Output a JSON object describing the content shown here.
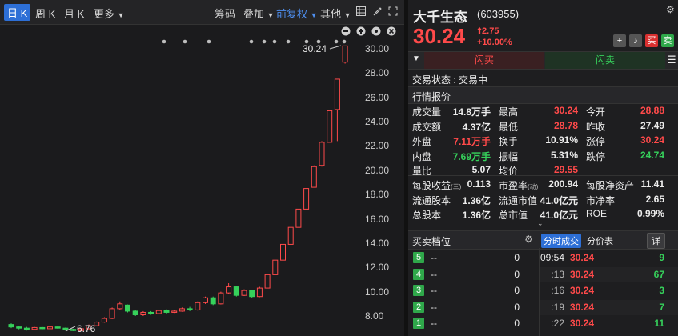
{
  "toolbar": {
    "tabs": [
      "日 K",
      "周 K",
      "月 K",
      "更多"
    ],
    "selected": 0,
    "right_items": [
      "筹码",
      "叠加",
      "前复权",
      "其他"
    ]
  },
  "chart": {
    "price_high_label": "30.24",
    "price_low_label": "6.76",
    "y_ticks": [
      "30.00",
      "28.00",
      "26.00",
      "24.00",
      "22.00",
      "20.00",
      "18.00",
      "16.00",
      "14.00",
      "12.00",
      "10.00",
      "8.00"
    ],
    "y_min": 7.0,
    "y_max": 30.0
  },
  "chart_data": {
    "type": "candlestick",
    "title": "",
    "ylim": [
      7,
      30
    ],
    "candles": [
      {
        "o": 7.3,
        "c": 7.1,
        "h": 7.4,
        "l": 7.0
      },
      {
        "o": 7.1,
        "c": 7.0,
        "h": 7.2,
        "l": 6.9
      },
      {
        "o": 7.0,
        "c": 6.9,
        "h": 7.1,
        "l": 6.8
      },
      {
        "o": 6.9,
        "c": 7.05,
        "h": 7.1,
        "l": 6.85
      },
      {
        "o": 7.05,
        "c": 6.95,
        "h": 7.1,
        "l": 6.9
      },
      {
        "o": 6.95,
        "c": 7.1,
        "h": 7.2,
        "l": 6.9
      },
      {
        "o": 7.1,
        "c": 7.0,
        "h": 7.15,
        "l": 6.95
      },
      {
        "o": 7.0,
        "c": 6.9,
        "h": 7.05,
        "l": 6.8
      },
      {
        "o": 6.9,
        "c": 6.8,
        "h": 6.95,
        "l": 6.76
      },
      {
        "o": 6.8,
        "c": 6.95,
        "h": 7.0,
        "l": 6.76
      },
      {
        "o": 6.95,
        "c": 7.2,
        "h": 7.3,
        "l": 6.9
      },
      {
        "o": 7.2,
        "c": 7.5,
        "h": 7.55,
        "l": 7.15
      },
      {
        "o": 7.5,
        "c": 7.8,
        "h": 7.9,
        "l": 7.45
      },
      {
        "o": 7.8,
        "c": 8.6,
        "h": 8.7,
        "l": 7.75
      },
      {
        "o": 8.6,
        "c": 9.0,
        "h": 9.2,
        "l": 8.5
      },
      {
        "o": 8.9,
        "c": 8.4,
        "h": 8.95,
        "l": 8.3
      },
      {
        "o": 8.4,
        "c": 8.1,
        "h": 8.5,
        "l": 8.0
      },
      {
        "o": 8.1,
        "c": 8.3,
        "h": 8.4,
        "l": 8.0
      },
      {
        "o": 8.3,
        "c": 8.2,
        "h": 8.4,
        "l": 8.1
      },
      {
        "o": 8.2,
        "c": 8.45,
        "h": 8.5,
        "l": 8.15
      },
      {
        "o": 8.45,
        "c": 8.3,
        "h": 8.55,
        "l": 8.2
      },
      {
        "o": 8.3,
        "c": 8.4,
        "h": 8.5,
        "l": 8.25
      },
      {
        "o": 8.4,
        "c": 8.6,
        "h": 8.7,
        "l": 8.35
      },
      {
        "o": 8.6,
        "c": 8.5,
        "h": 8.75,
        "l": 8.4
      },
      {
        "o": 8.5,
        "c": 9.1,
        "h": 9.2,
        "l": 8.45
      },
      {
        "o": 9.1,
        "c": 9.5,
        "h": 9.6,
        "l": 9.0
      },
      {
        "o": 9.5,
        "c": 9.0,
        "h": 9.6,
        "l": 8.9
      },
      {
        "o": 9.0,
        "c": 9.9,
        "h": 10.0,
        "l": 8.95
      },
      {
        "o": 9.9,
        "c": 10.4,
        "h": 10.7,
        "l": 9.8
      },
      {
        "o": 10.4,
        "c": 9.7,
        "h": 10.5,
        "l": 9.6
      },
      {
        "o": 9.7,
        "c": 10.1,
        "h": 10.2,
        "l": 9.65
      },
      {
        "o": 10.1,
        "c": 9.6,
        "h": 10.15,
        "l": 9.5
      },
      {
        "o": 9.6,
        "c": 10.3,
        "h": 10.4,
        "l": 9.55
      },
      {
        "o": 10.3,
        "c": 11.4,
        "h": 11.4,
        "l": 10.3
      },
      {
        "o": 11.4,
        "c": 12.6,
        "h": 12.6,
        "l": 11.4
      },
      {
        "o": 12.6,
        "c": 13.9,
        "h": 13.9,
        "l": 12.6
      },
      {
        "o": 13.9,
        "c": 15.3,
        "h": 15.3,
        "l": 13.9
      },
      {
        "o": 15.3,
        "c": 16.8,
        "h": 16.8,
        "l": 15.3
      },
      {
        "o": 16.8,
        "c": 18.5,
        "h": 18.5,
        "l": 16.8
      },
      {
        "o": 18.6,
        "c": 20.3,
        "h": 20.4,
        "l": 18.6
      },
      {
        "o": 20.4,
        "c": 22.3,
        "h": 22.4,
        "l": 20.3
      },
      {
        "o": 22.3,
        "c": 24.9,
        "h": 24.9,
        "l": 22.3
      },
      {
        "o": 25.0,
        "c": 27.5,
        "h": 27.5,
        "l": 22.4
      },
      {
        "o": 28.9,
        "c": 30.24,
        "h": 30.24,
        "l": 28.78
      }
    ]
  },
  "stock": {
    "name": "大千生态",
    "code": "(603955)",
    "price": "30.24",
    "change": "2.75",
    "change_pct": "+10.00%",
    "flash_buy": "闪买",
    "flash_sell": "闪卖",
    "buy_btn": "买",
    "sell_btn": "卖",
    "status": "交易状态 : 交易中"
  },
  "quote": {
    "header": "行情报价",
    "rows": [
      [
        {
          "l": "成交量",
          "v": "14.8万手",
          "c": "white"
        },
        {
          "l": "最高",
          "v": "30.24",
          "c": "red"
        },
        {
          "l": "今开",
          "v": "28.88",
          "c": "red"
        }
      ],
      [
        {
          "l": "成交额",
          "v": "4.37亿",
          "c": "white"
        },
        {
          "l": "最低",
          "v": "28.78",
          "c": "red"
        },
        {
          "l": "昨收",
          "v": "27.49",
          "c": "white"
        }
      ],
      [
        {
          "l": "外盘",
          "v": "7.11万手",
          "c": "red"
        },
        {
          "l": "换手",
          "v": "10.91%",
          "c": "white"
        },
        {
          "l": "涨停",
          "v": "30.24",
          "c": "red"
        }
      ],
      [
        {
          "l": "内盘",
          "v": "7.69万手",
          "c": "green"
        },
        {
          "l": "振幅",
          "v": "5.31%",
          "c": "white"
        },
        {
          "l": "跌停",
          "v": "24.74",
          "c": "green"
        }
      ],
      [
        {
          "l": "量比",
          "v": "5.07",
          "c": "white"
        },
        {
          "l": "均价",
          "v": "29.55",
          "c": "red"
        },
        {
          "l": "",
          "v": "",
          "c": "white"
        }
      ]
    ],
    "rows2": [
      [
        {
          "l": "每股收益",
          "sub": "(三)",
          "v": "0.113",
          "c": "white"
        },
        {
          "l": "市盈率",
          "sub": "(动)",
          "v": "200.94",
          "c": "white"
        },
        {
          "l": "每股净资产",
          "v": "11.41",
          "c": "white"
        }
      ],
      [
        {
          "l": "流通股本",
          "v": "1.36亿",
          "c": "white"
        },
        {
          "l": "流通市值",
          "v": "41.0亿元",
          "c": "white"
        },
        {
          "l": "市净率",
          "v": "2.65",
          "c": "white"
        }
      ],
      [
        {
          "l": "总股本",
          "v": "1.36亿",
          "c": "white"
        },
        {
          "l": "总市值",
          "v": "41.0亿元",
          "c": "white"
        },
        {
          "l": "ROE",
          "v": "0.99%",
          "c": "white"
        }
      ]
    ]
  },
  "orderbook": {
    "title": "买卖档位",
    "levels": [
      {
        "n": "5",
        "price": "--",
        "vol": "0"
      },
      {
        "n": "4",
        "price": "--",
        "vol": "0"
      },
      {
        "n": "3",
        "price": "--",
        "vol": "0"
      },
      {
        "n": "2",
        "price": "--",
        "vol": "0"
      },
      {
        "n": "1",
        "price": "--",
        "vol": "0"
      }
    ]
  },
  "ticks": {
    "tab_active": "分时成交",
    "tab_other": "分价表",
    "detail": "详",
    "rows": [
      {
        "t": "09:54",
        "p": "30.24",
        "v": "9",
        "vc": "green"
      },
      {
        "t": ":13",
        "p": "30.24",
        "v": "67",
        "vc": "green"
      },
      {
        "t": ":16",
        "p": "30.24",
        "v": "3",
        "vc": "green"
      },
      {
        "t": ":19",
        "p": "30.24",
        "v": "7",
        "vc": "green"
      },
      {
        "t": ":22",
        "p": "30.24",
        "v": "11",
        "vc": "green"
      }
    ]
  },
  "colors": {
    "up": "#ff4a4a",
    "down": "#36d15b",
    "accent": "#2d6fd6"
  }
}
